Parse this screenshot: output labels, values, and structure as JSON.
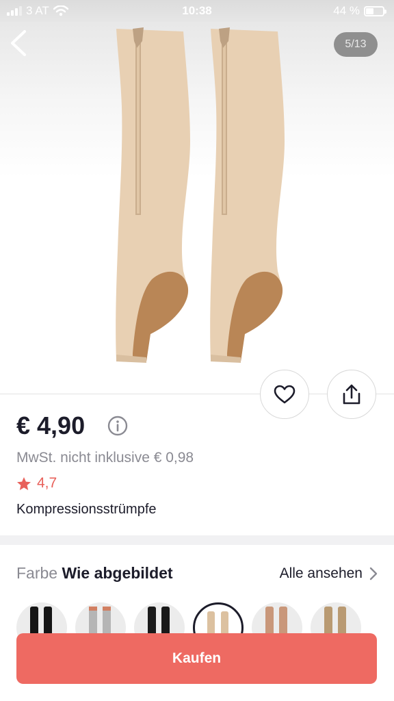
{
  "status_bar": {
    "carrier": "3 AT",
    "time": "10:38",
    "battery": "44 %",
    "battery_level": 0.44
  },
  "gallery": {
    "counter": "5/13"
  },
  "product": {
    "price": "€ 4,90",
    "vat_note": "MwSt. nicht inklusive € 0,98",
    "rating": "4,7",
    "title": "Kompressionsstrümpfe"
  },
  "variant": {
    "label": "Farbe",
    "value": "Wie abgebildet",
    "see_all": "Alle ansehen"
  },
  "actions": {
    "buy_label": "Kaufen"
  },
  "icons": {
    "back": "chevron-left-icon",
    "favorite": "heart-icon",
    "share": "share-icon",
    "info": "info-icon",
    "rating": "star-icon",
    "see_all": "chevron-right-icon"
  },
  "colors": {
    "accent": "#ee6a62",
    "rating": "#e8605a",
    "text": "#1c1c2a",
    "muted": "#8a8a92"
  }
}
